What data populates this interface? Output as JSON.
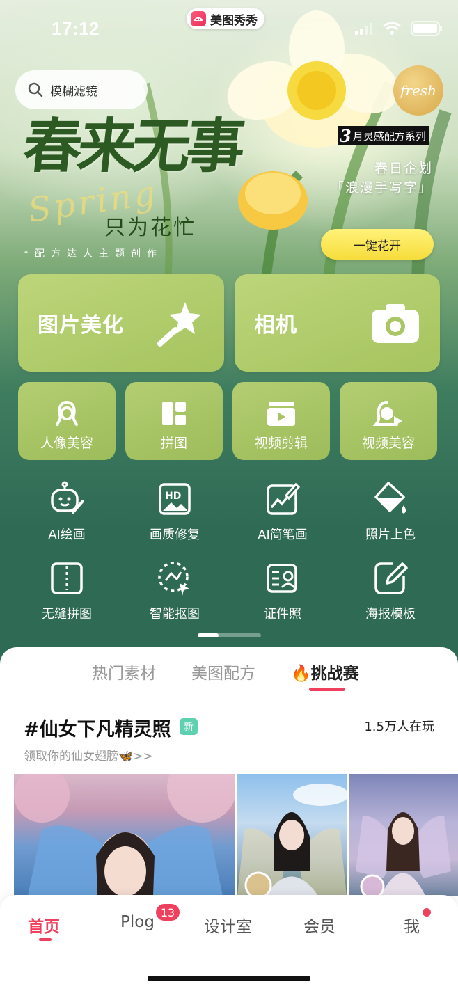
{
  "status_bar": {
    "time": "17:12",
    "app_name": "美图秀秀"
  },
  "search": {
    "placeholder": "模糊滤镜"
  },
  "hero": {
    "badge": "fresh",
    "title": "春来无事",
    "script": "Spring",
    "subtitle": "只为花忙",
    "credit": "*配方达人主题创作",
    "series_num": "3",
    "series_label": "月灵感配方系列",
    "plan_line1": "春日企划",
    "plan_line2": "「浪漫手写字」",
    "cta": "一键花开"
  },
  "primary_tiles": [
    {
      "label": "图片美化",
      "icon": "magic-wand-icon"
    },
    {
      "label": "相机",
      "icon": "camera-icon"
    }
  ],
  "secondary_tiles": [
    {
      "label": "人像美容",
      "icon": "portrait-icon"
    },
    {
      "label": "拼图",
      "icon": "collage-icon"
    },
    {
      "label": "视频剪辑",
      "icon": "video-clip-icon"
    },
    {
      "label": "视频美容",
      "icon": "video-beauty-icon"
    }
  ],
  "tools": [
    {
      "label": "AI绘画",
      "icon": "robot-paint-icon"
    },
    {
      "label": "画质修复",
      "icon": "hd-icon"
    },
    {
      "label": "AI简笔画",
      "icon": "sketch-icon"
    },
    {
      "label": "照片上色",
      "icon": "paint-bucket-icon"
    },
    {
      "label": "无缝拼图",
      "icon": "seamless-collage-icon"
    },
    {
      "label": "智能抠图",
      "icon": "cutout-icon"
    },
    {
      "label": "证件照",
      "icon": "id-photo-icon"
    },
    {
      "label": "海报模板",
      "icon": "poster-icon"
    }
  ],
  "feed_tabs": [
    {
      "label": "热门素材"
    },
    {
      "label": "美图配方"
    },
    {
      "label": "🔥挑战赛",
      "active": true
    }
  ],
  "challenge": {
    "title": "#仙女下凡精灵照",
    "new_badge": "新",
    "players": "1.5万人在玩",
    "subtitle": "领取你的仙女翅膀🦋>>"
  },
  "tab_bar": {
    "items": [
      {
        "label": "首页",
        "active": true
      },
      {
        "label": "Plog"
      },
      {
        "label": "设计室"
      },
      {
        "label": "会员"
      },
      {
        "label": "我"
      }
    ],
    "plog_badge": "13"
  },
  "colors": {
    "accent": "#f0405e",
    "tile_green": "#b3ce72",
    "bg_green": "#2f6a55",
    "cta_yellow": "#f6dd3c"
  }
}
